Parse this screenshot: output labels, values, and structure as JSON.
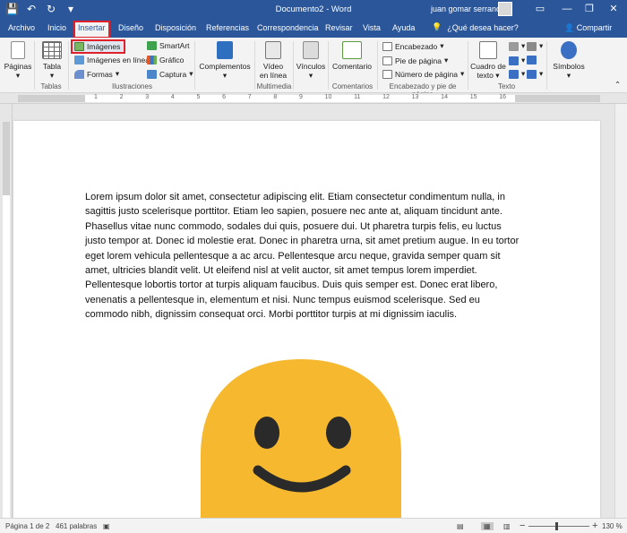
{
  "window": {
    "doc_title": "Documento2 - Word",
    "user_name": "juan gomar serrano",
    "minimize": "—",
    "restore": "❐",
    "close": "✕"
  },
  "quick_access": {
    "save": "💾",
    "undo": "↶",
    "redo": "↻",
    "customize": "▾"
  },
  "tabs": [
    {
      "label": "Archivo"
    },
    {
      "label": "Inicio"
    },
    {
      "label": "Insertar",
      "active": true
    },
    {
      "label": "Diseño"
    },
    {
      "label": "Disposición"
    },
    {
      "label": "Referencias"
    },
    {
      "label": "Correspondencia"
    },
    {
      "label": "Revisar"
    },
    {
      "label": "Vista"
    },
    {
      "label": "Ayuda"
    }
  ],
  "tell_me": "¿Qué desea hacer?",
  "share": "Compartir",
  "ribbon": {
    "groups": {
      "tablas": "Tablas",
      "ilustraciones": "Ilustraciones",
      "multimedia": "Multimedia",
      "comentarios": "Comentarios",
      "encabezado": "Encabezado y pie de página",
      "texto": "Texto"
    },
    "paginas": "Páginas",
    "tabla": "Tabla",
    "imagenes": "Imágenes",
    "imagenes_linea": "Imágenes en línea",
    "formas": "Formas",
    "smartart": "SmartArt",
    "grafico": "Gráfico",
    "captura": "Captura",
    "complementos": "Complementos",
    "video_linea_1": "Vídeo",
    "video_linea_2": "en línea",
    "vinculos": "Vínculos",
    "comentario": "Comentario",
    "encabezado": "Encabezado",
    "pie_pagina": "Pie de página",
    "numero_pagina": "Número de página",
    "cuadro_texto_1": "Cuadro de",
    "cuadro_texto_2": "texto",
    "simbolos": "Símbolos",
    "accent": "#2b579a",
    "highlight": "#e0202a"
  },
  "document": {
    "paragraph": "Lorem ipsum dolor sit amet, consectetur adipiscing elit. Etiam consectetur condimentum nulla, in sagittis justo scelerisque porttitor. Etiam leo sapien, posuere nec ante at, aliquam tincidunt ante. Phasellus vitae nunc commodo, sodales dui quis, posuere dui. Ut pharetra turpis felis, eu luctus justo tempor at. Donec id molestie erat. Donec in pharetra urna, sit amet pretium augue. In eu tortor eget lorem vehicula pellentesque a ac arcu. Pellentesque arcu neque, gravida semper quam sit amet, ultricies blandit velit. Ut eleifend nisl at velit auctor, sit amet tempus lorem imperdiet. Pellentesque lobortis tortor at turpis aliquam faucibus. Duis quis semper est. Donec erat libero, venenatis a pellentesque in, elementum et nisi. Nunc tempus euismod scelerisque. Sed eu commodo nibh, dignissim consequat orci. Morbi porttitor turpis at mi dignissim iaculis.",
    "image_color": "#f5b82e",
    "image_feature_color": "#2a2a2a"
  },
  "status": {
    "page": "Página 1 de 2",
    "words": "461 palabras",
    "zoom": "130 %",
    "zoom_out": "−",
    "zoom_in": "+"
  },
  "ruler_numbers": [
    "1",
    "2",
    "3",
    "4",
    "5",
    "6",
    "7",
    "8",
    "9",
    "10",
    "11",
    "12",
    "13",
    "14",
    "15",
    "16"
  ]
}
